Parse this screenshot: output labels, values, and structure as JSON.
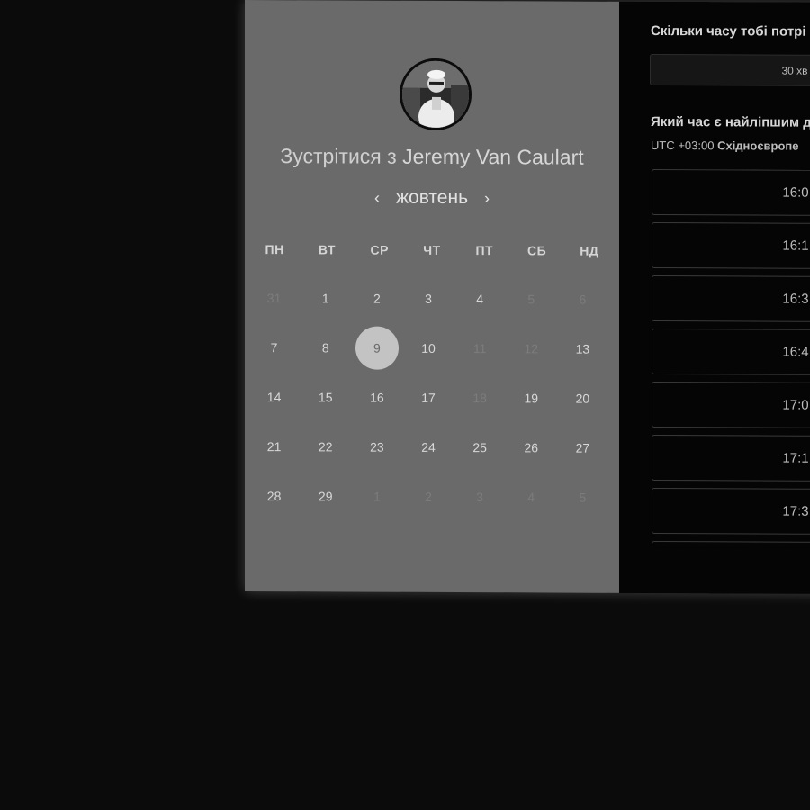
{
  "host": {
    "title_prefix": "Зустрітися з",
    "name": "Jeremy Van Caulart",
    "avatar_icon": "person-photo-icon"
  },
  "calendar": {
    "month": "жовтень",
    "prev_icon": "chevron-left-icon",
    "next_icon": "chevron-right-icon",
    "weekdays": [
      "ПН",
      "ВТ",
      "СР",
      "ЧТ",
      "ПТ",
      "СБ",
      "НД"
    ],
    "selected_day": "9",
    "days": [
      {
        "label": "31",
        "muted": true
      },
      {
        "label": "1",
        "muted": false
      },
      {
        "label": "2",
        "muted": false
      },
      {
        "label": "3",
        "muted": false
      },
      {
        "label": "4",
        "muted": false
      },
      {
        "label": "5",
        "muted": true
      },
      {
        "label": "6",
        "muted": true
      },
      {
        "label": "7",
        "muted": false
      },
      {
        "label": "8",
        "muted": false
      },
      {
        "label": "9",
        "muted": false,
        "selected": true
      },
      {
        "label": "10",
        "muted": false
      },
      {
        "label": "11",
        "muted": true
      },
      {
        "label": "12",
        "muted": true
      },
      {
        "label": "13",
        "muted": false
      },
      {
        "label": "14",
        "muted": false
      },
      {
        "label": "15",
        "muted": false
      },
      {
        "label": "16",
        "muted": false
      },
      {
        "label": "17",
        "muted": false
      },
      {
        "label": "18",
        "muted": true
      },
      {
        "label": "19",
        "muted": false
      },
      {
        "label": "20",
        "muted": false
      },
      {
        "label": "21",
        "muted": false
      },
      {
        "label": "22",
        "muted": false
      },
      {
        "label": "23",
        "muted": false
      },
      {
        "label": "24",
        "muted": false
      },
      {
        "label": "25",
        "muted": false
      },
      {
        "label": "26",
        "muted": false
      },
      {
        "label": "27",
        "muted": false
      },
      {
        "label": "28",
        "muted": false
      },
      {
        "label": "29",
        "muted": false
      },
      {
        "label": "1",
        "muted": true
      },
      {
        "label": "2",
        "muted": true
      },
      {
        "label": "3",
        "muted": true
      },
      {
        "label": "4",
        "muted": true
      },
      {
        "label": "5",
        "muted": true
      }
    ]
  },
  "duration_section": {
    "question": "Скільки часу тобі потрі",
    "selected": "30 хв"
  },
  "time_section": {
    "question": "Який час є найліпшим д",
    "tz_offset": "UTC +03:00",
    "tz_name": "Східноєвропе"
  },
  "time_slots": [
    "16:0",
    "16:1",
    "16:3",
    "16:4",
    "17:0",
    "17:1",
    "17:3",
    ""
  ],
  "colors": {
    "page_bg": "#0b0b0b",
    "left_panel_bg": "#6a6a6a",
    "right_panel_bg": "#050505",
    "selected_day_bg": "#c3c3c3"
  }
}
